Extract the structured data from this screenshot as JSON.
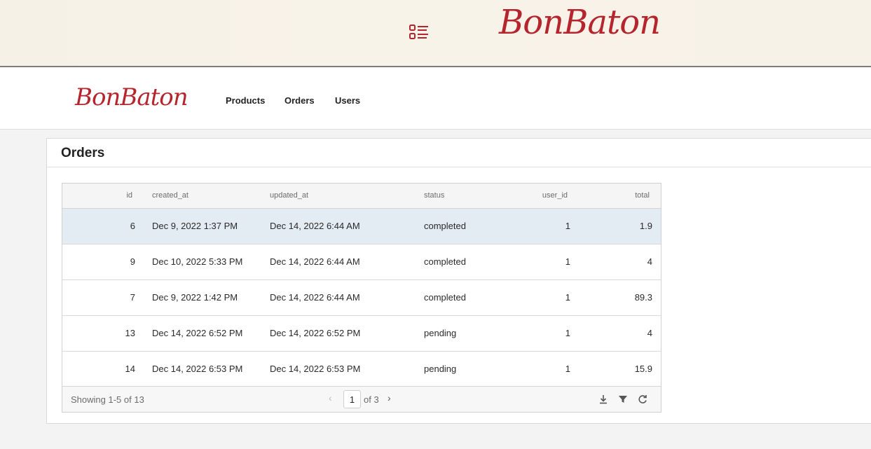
{
  "banner": {
    "brand": "BonBaton"
  },
  "navbar": {
    "brand": "BonBaton",
    "links": [
      "Products",
      "Orders",
      "Users"
    ]
  },
  "panel": {
    "title": "Orders"
  },
  "table": {
    "columns": [
      "id",
      "created_at",
      "updated_at",
      "status",
      "user_id",
      "total"
    ],
    "rows": [
      [
        "6",
        "Dec 9, 2022 1:37 PM",
        "Dec 14, 2022 6:44 AM",
        "completed",
        "1",
        "1.9"
      ],
      [
        "9",
        "Dec 10, 2022 5:33 PM",
        "Dec 14, 2022 6:44 AM",
        "completed",
        "1",
        "4"
      ],
      [
        "7",
        "Dec 9, 2022 1:42 PM",
        "Dec 14, 2022 6:44 AM",
        "completed",
        "1",
        "89.3"
      ],
      [
        "13",
        "Dec 14, 2022 6:52 PM",
        "Dec 14, 2022 6:52 PM",
        "pending",
        "1",
        "4"
      ],
      [
        "14",
        "Dec 14, 2022 6:53 PM",
        "Dec 14, 2022 6:53 PM",
        "pending",
        "1",
        "15.9"
      ]
    ],
    "selected_row": 0
  },
  "footer": {
    "summary": "Showing 1-5 of 13",
    "page": "1",
    "of_pages": "of 3"
  },
  "colors": {
    "brand": "#b5252d",
    "selected_row": "#e3ebf3"
  }
}
